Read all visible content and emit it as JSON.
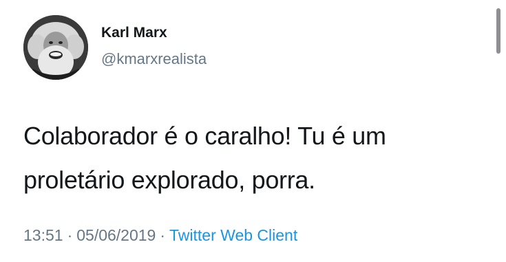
{
  "tweet": {
    "author": {
      "display_name": "Karl Marx",
      "handle": "@kmarxrealista",
      "avatar_icon": "profile-photo"
    },
    "text_lines": [
      "Colaborador é o caralho! Tu é um",
      "proletário explorado, porra."
    ],
    "meta": {
      "time": "13:51",
      "separator": "·",
      "date": "05/06/2019",
      "client": "Twitter Web Client"
    }
  },
  "colors": {
    "text": "#14171a",
    "secondary": "#657786",
    "link": "#1b95e0",
    "background": "#ffffff"
  }
}
